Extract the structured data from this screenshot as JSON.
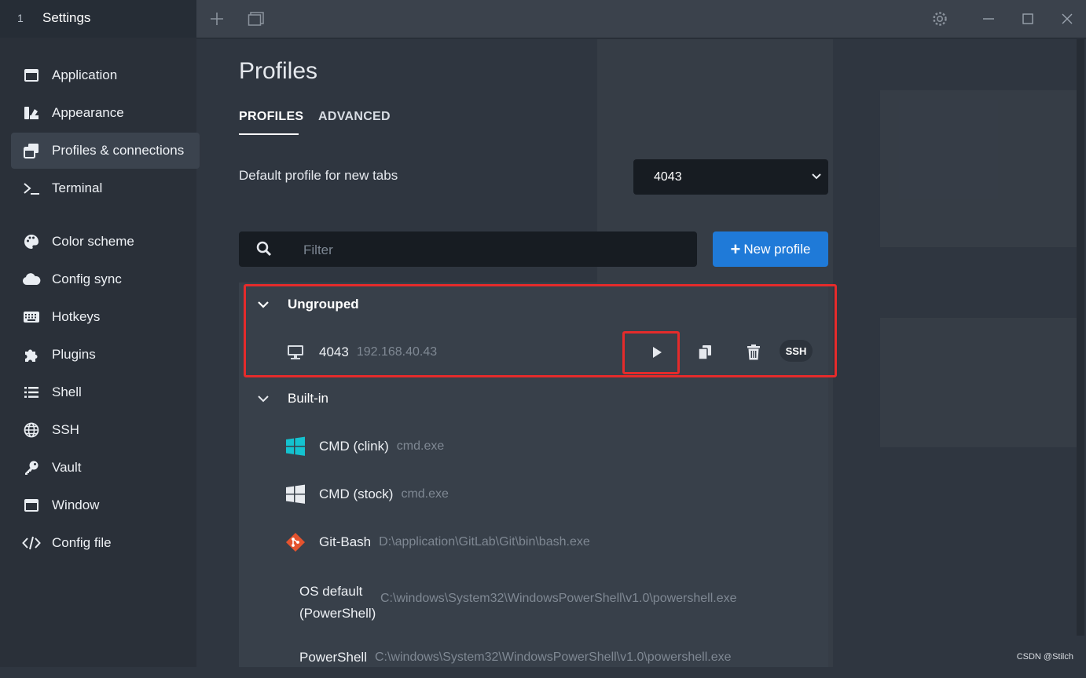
{
  "titlebar": {
    "tab_number": "1",
    "tab_title": "Settings",
    "icons": [
      "plus-icon",
      "window-icon",
      "gear-icon",
      "minimize-icon",
      "maximize-icon",
      "close-icon"
    ]
  },
  "sidebar": {
    "items": [
      {
        "label": "Application",
        "icon": "window-icon"
      },
      {
        "label": "Appearance",
        "icon": "brush-icon"
      },
      {
        "label": "Profiles & connections",
        "icon": "windows-stack-icon",
        "active": true
      },
      {
        "label": "Terminal",
        "icon": "terminal-icon"
      },
      {
        "label": "Color scheme",
        "icon": "palette-icon"
      },
      {
        "label": "Config sync",
        "icon": "cloud-icon"
      },
      {
        "label": "Hotkeys",
        "icon": "keyboard-icon"
      },
      {
        "label": "Plugins",
        "icon": "puzzle-icon"
      },
      {
        "label": "Shell",
        "icon": "list-icon"
      },
      {
        "label": "SSH",
        "icon": "globe-icon"
      },
      {
        "label": "Vault",
        "icon": "key-icon"
      },
      {
        "label": "Window",
        "icon": "window-icon"
      },
      {
        "label": "Config file",
        "icon": "code-icon"
      }
    ]
  },
  "main": {
    "title": "Profiles",
    "tabs": [
      {
        "label": "PROFILES",
        "active": true
      },
      {
        "label": "ADVANCED",
        "active": false
      }
    ],
    "default_profile_label": "Default profile for new tabs",
    "default_profile_value": "4043",
    "filter_placeholder": "Filter",
    "new_profile_label": "New profile",
    "accent_color": "#1f7ad8",
    "highlight_color": "#e52b2b"
  },
  "groups": [
    {
      "name": "Ungrouped",
      "profiles": [
        {
          "name": "4043",
          "desc": "192.168.40.43",
          "icon": "monitor-icon",
          "badge": "SSH"
        }
      ]
    },
    {
      "name": "Built-in",
      "profiles": [
        {
          "name": "CMD (clink)",
          "desc": "cmd.exe",
          "icon": "windows-logo-icon"
        },
        {
          "name": "CMD (stock)",
          "desc": "cmd.exe",
          "icon": "windows-logo-icon"
        },
        {
          "name": "Git-Bash",
          "desc": "D:\\application\\GitLab\\Git\\bin\\bash.exe",
          "icon": "git-icon"
        },
        {
          "name_line1": "OS default",
          "name_line2": "(PowerShell)",
          "desc": "C:\\windows\\System32\\WindowsPowerShell\\v1.0\\powershell.exe"
        },
        {
          "name": "PowerShell",
          "desc": "C:\\windows\\System32\\WindowsPowerShell\\v1.0\\powershell.exe"
        }
      ]
    }
  ],
  "watermark": "CSDN @Stilch"
}
